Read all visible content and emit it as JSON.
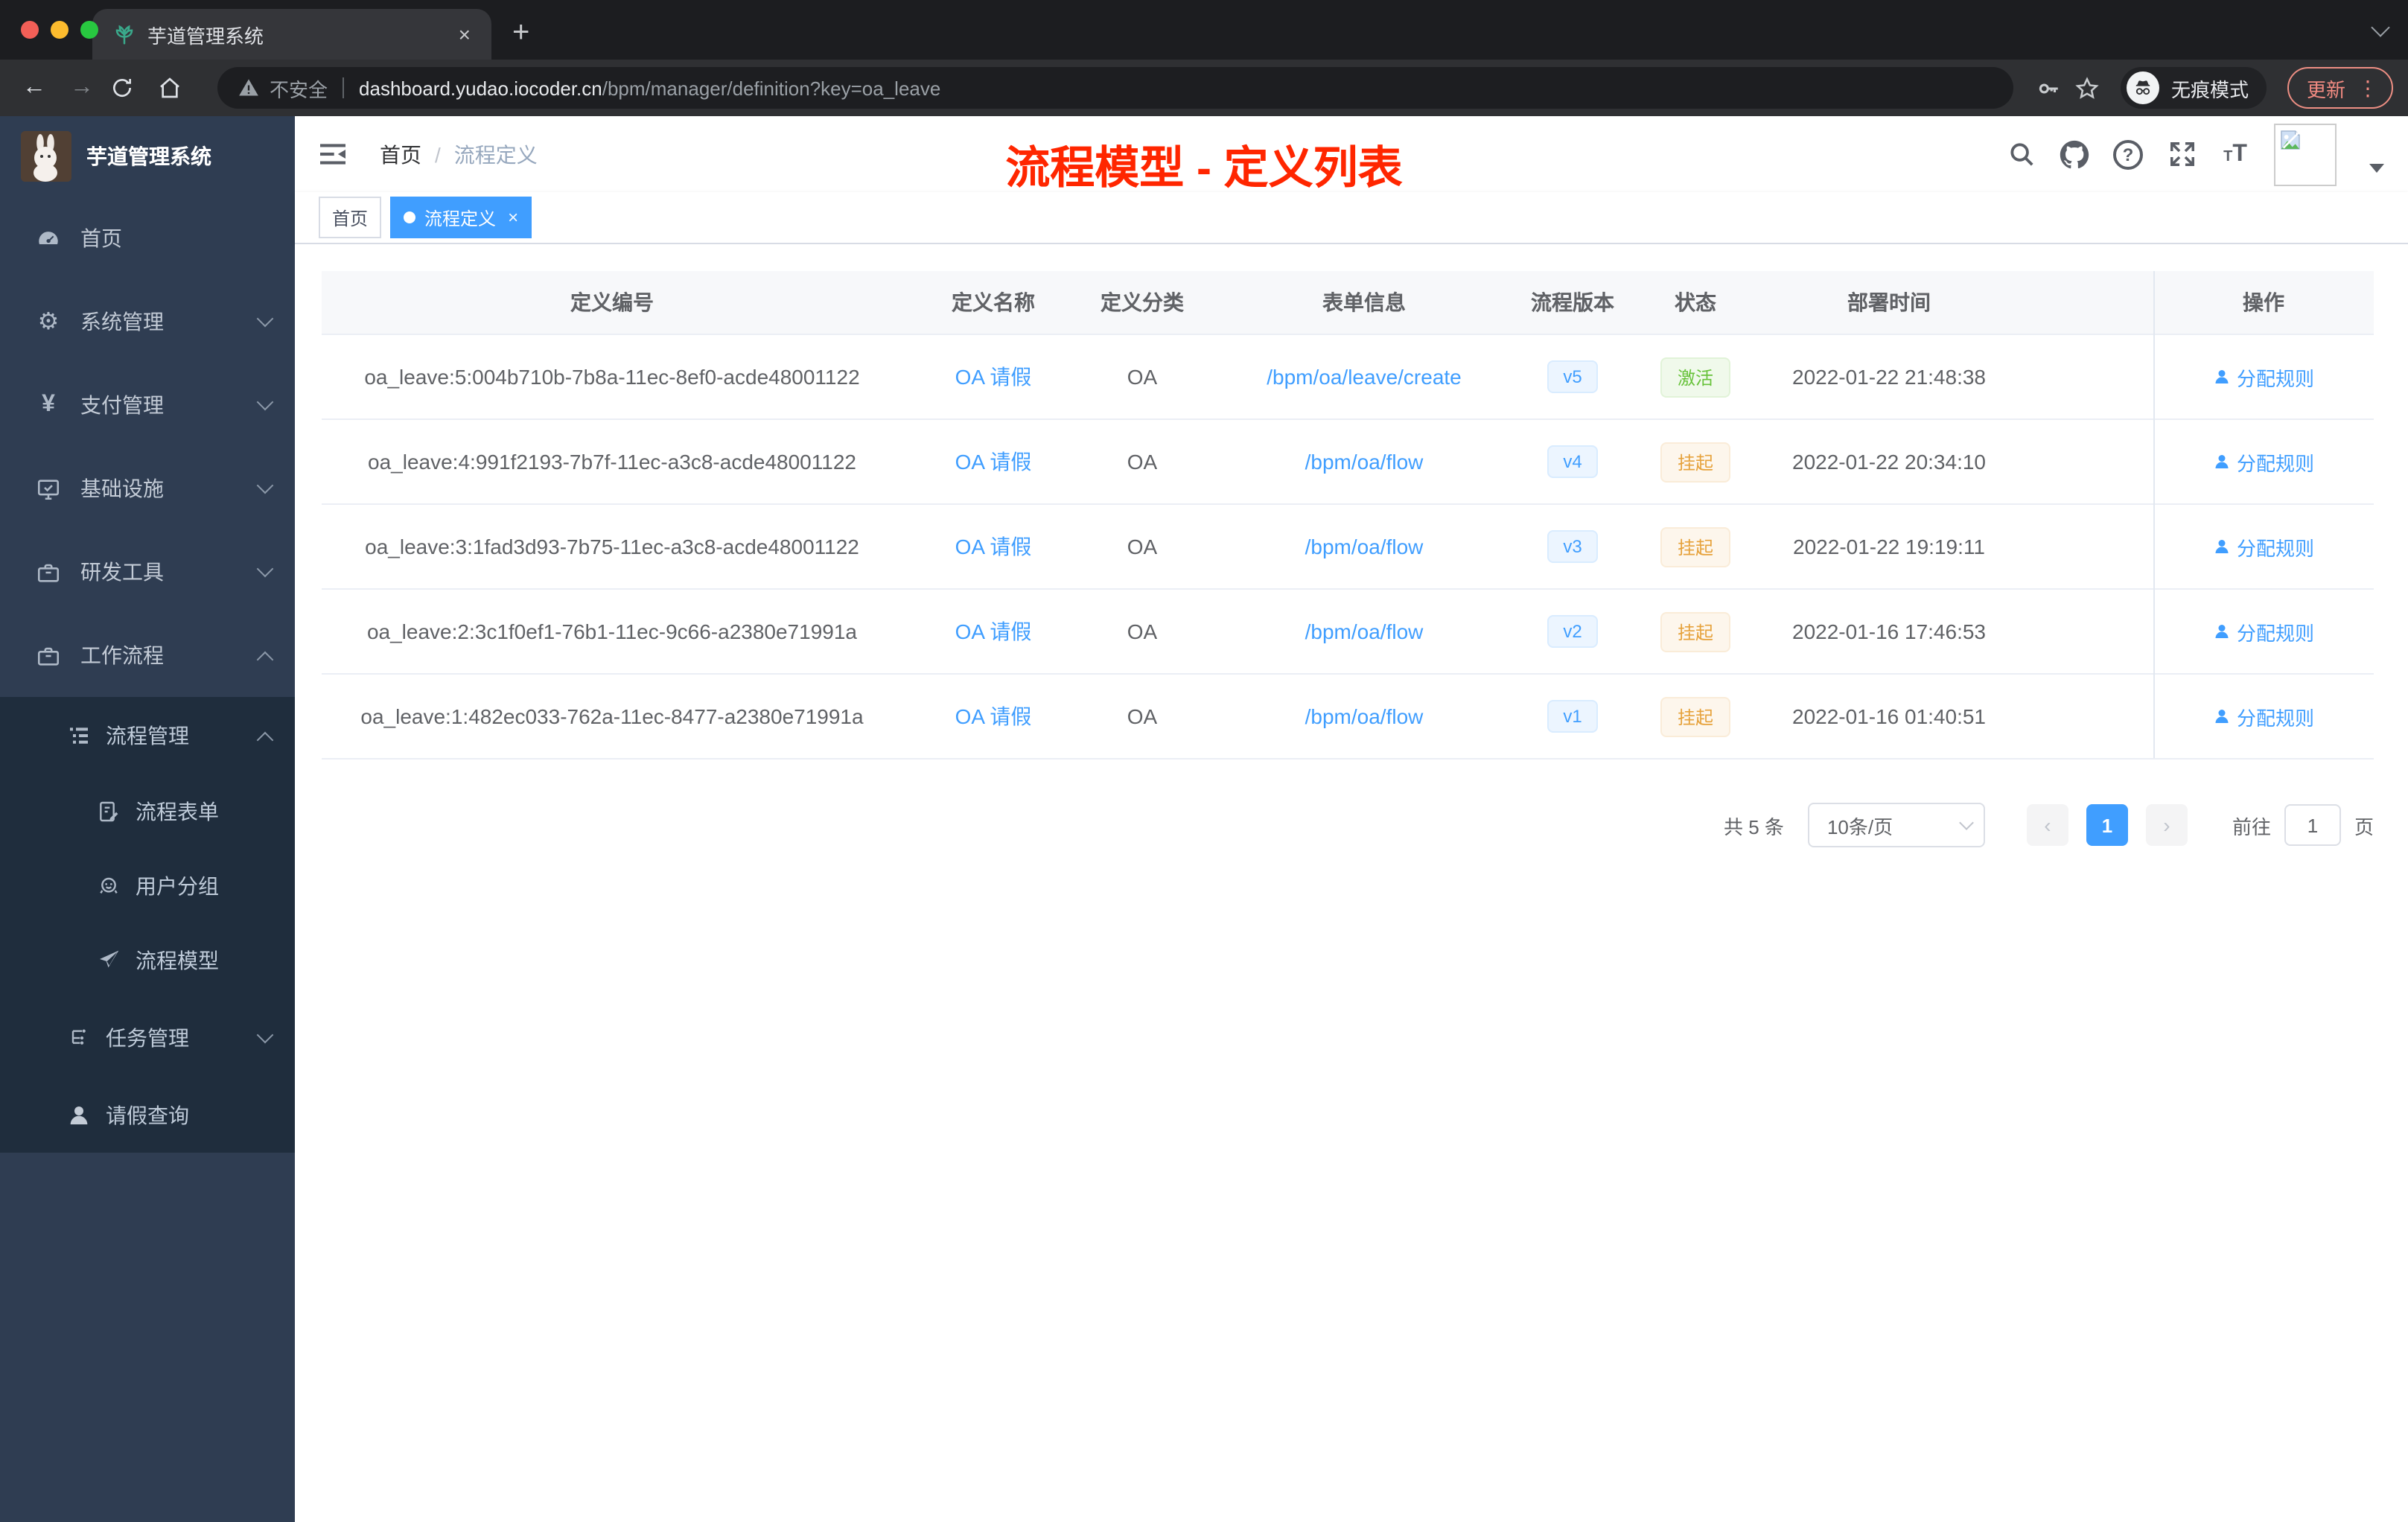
{
  "browser": {
    "tab_title": "芋道管理系统",
    "tab_close": "×",
    "new_tab": "+",
    "security_label": "不安全",
    "url_host": "dashboard.yudao.iocoder.cn",
    "url_path": "/bpm/manager/definition?key=oa_leave",
    "incognito_label": "无痕模式",
    "update_label": "更新",
    "menu_dots": "⋮",
    "traffic_colors": {
      "close": "#f35f57",
      "min": "#fdbc2e",
      "max": "#28c840"
    }
  },
  "annotation": {
    "title": "流程模型 - 定义列表",
    "color": "#ff2600"
  },
  "sidebar": {
    "app_title": "芋道管理系统",
    "menu": [
      {
        "label": "首页",
        "icon": "dashboard-icon"
      },
      {
        "label": "系统管理",
        "icon": "gear-icon"
      },
      {
        "label": "支付管理",
        "icon": "yen-icon"
      },
      {
        "label": "基础设施",
        "icon": "monitor-icon"
      },
      {
        "label": "研发工具",
        "icon": "toolbox-icon"
      },
      {
        "label": "工作流程",
        "icon": "toolbox-icon"
      }
    ],
    "submenu": [
      {
        "label": "流程管理",
        "icon": "tree-list-icon"
      },
      {
        "label": "流程表单",
        "icon": "form-icon"
      },
      {
        "label": "用户分组",
        "icon": "people-icon"
      },
      {
        "label": "流程模型",
        "icon": "paper-plane-icon"
      },
      {
        "label": "任务管理",
        "icon": "org-icon"
      },
      {
        "label": "请假查询",
        "icon": "user-icon"
      }
    ]
  },
  "header": {
    "breadcrumb_home": "首页",
    "breadcrumb_sep": "/",
    "breadcrumb_current": "流程定义"
  },
  "tags": {
    "home": "首页",
    "active": "流程定义",
    "close": "×"
  },
  "table": {
    "columns": [
      "定义编号",
      "定义名称",
      "定义分类",
      "表单信息",
      "流程版本",
      "状态",
      "部署时间",
      "操作"
    ],
    "rows": [
      {
        "id": "oa_leave:5:004b710b-7b8a-11ec-8ef0-acde48001122",
        "name": "OA 请假",
        "category": "OA",
        "form": "/bpm/oa/leave/create",
        "version": "v5",
        "status": "激活",
        "status_type": "success",
        "deployed": "2022-01-22 21:48:38",
        "action": "分配规则"
      },
      {
        "id": "oa_leave:4:991f2193-7b7f-11ec-a3c8-acde48001122",
        "name": "OA 请假",
        "category": "OA",
        "form": "/bpm/oa/flow",
        "version": "v4",
        "status": "挂起",
        "status_type": "warning",
        "deployed": "2022-01-22 20:34:10",
        "action": "分配规则"
      },
      {
        "id": "oa_leave:3:1fad3d93-7b75-11ec-a3c8-acde48001122",
        "name": "OA 请假",
        "category": "OA",
        "form": "/bpm/oa/flow",
        "version": "v3",
        "status": "挂起",
        "status_type": "warning",
        "deployed": "2022-01-22 19:19:11",
        "action": "分配规则"
      },
      {
        "id": "oa_leave:2:3c1f0ef1-76b1-11ec-9c66-a2380e71991a",
        "name": "OA 请假",
        "category": "OA",
        "form": "/bpm/oa/flow",
        "version": "v2",
        "status": "挂起",
        "status_type": "warning",
        "deployed": "2022-01-16 17:46:53",
        "action": "分配规则"
      },
      {
        "id": "oa_leave:1:482ec033-762a-11ec-8477-a2380e71991a",
        "name": "OA 请假",
        "category": "OA",
        "form": "/bpm/oa/flow",
        "version": "v1",
        "status": "挂起",
        "status_type": "warning",
        "deployed": "2022-01-16 01:40:51",
        "action": "分配规则"
      }
    ]
  },
  "pagination": {
    "total": "共 5 条",
    "page_size": "10条/页",
    "prev": "‹",
    "page": "1",
    "next": "›",
    "goto_label": "前往",
    "goto_value": "1",
    "goto_unit": "页"
  },
  "colors": {
    "accent": "#409eff",
    "success": "#67c23a",
    "warning": "#e6a23c",
    "sidebar_bg": "#2f3d52",
    "submenu_bg": "#1f2d3d"
  }
}
